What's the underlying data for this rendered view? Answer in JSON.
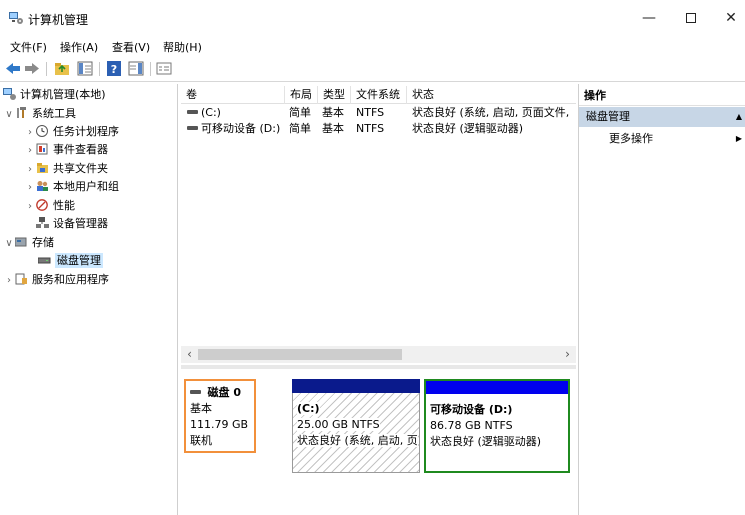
{
  "window": {
    "title": "计算机管理"
  },
  "menu": [
    "文件(F)",
    "操作(A)",
    "查看(V)",
    "帮助(H)"
  ],
  "tree": {
    "root": "计算机管理(本地)",
    "system_tools": "系统工具",
    "task_scheduler": "任务计划程序",
    "event_viewer": "事件查看器",
    "shared_folders": "共享文件夹",
    "local_users": "本地用户和组",
    "performance": "性能",
    "device_manager": "设备管理器",
    "storage": "存储",
    "disk_management": "磁盘管理",
    "services": "服务和应用程序"
  },
  "volume_list": {
    "columns": [
      "卷",
      "布局",
      "类型",
      "文件系统",
      "状态"
    ],
    "rows": [
      {
        "volume": "(C:)",
        "layout": "简单",
        "type": "基本",
        "fs": "NTFS",
        "status": "状态良好 (系统, 启动, 页面文件,"
      },
      {
        "volume": "可移动设备 (D:)",
        "layout": "简单",
        "type": "基本",
        "fs": "NTFS",
        "status": "状态良好 (逻辑驱动器)"
      }
    ]
  },
  "disk0": {
    "name": "磁盘 0",
    "kind": "基本",
    "size": "111.79 GB",
    "state": "联机",
    "partitions": [
      {
        "label": "(C:)",
        "size": "25.00 GB NTFS",
        "status": "状态良好 (系统, 启动, 页"
      },
      {
        "label": "可移动设备 (D:)",
        "size": "86.78 GB NTFS",
        "status": "状态良好 (逻辑驱动器)"
      }
    ]
  },
  "actions": {
    "header": "操作",
    "section": "磁盘管理",
    "more": "更多操作"
  },
  "colors": {
    "selection": "#cce8ff",
    "disk_highlight": "#f2903b",
    "primary_partition_bar": "#0a1a8c",
    "logical_partition_bar": "#0000ee",
    "selected_partition_border": "#1f8a1f",
    "action_section_bg": "#c7d6e6"
  }
}
